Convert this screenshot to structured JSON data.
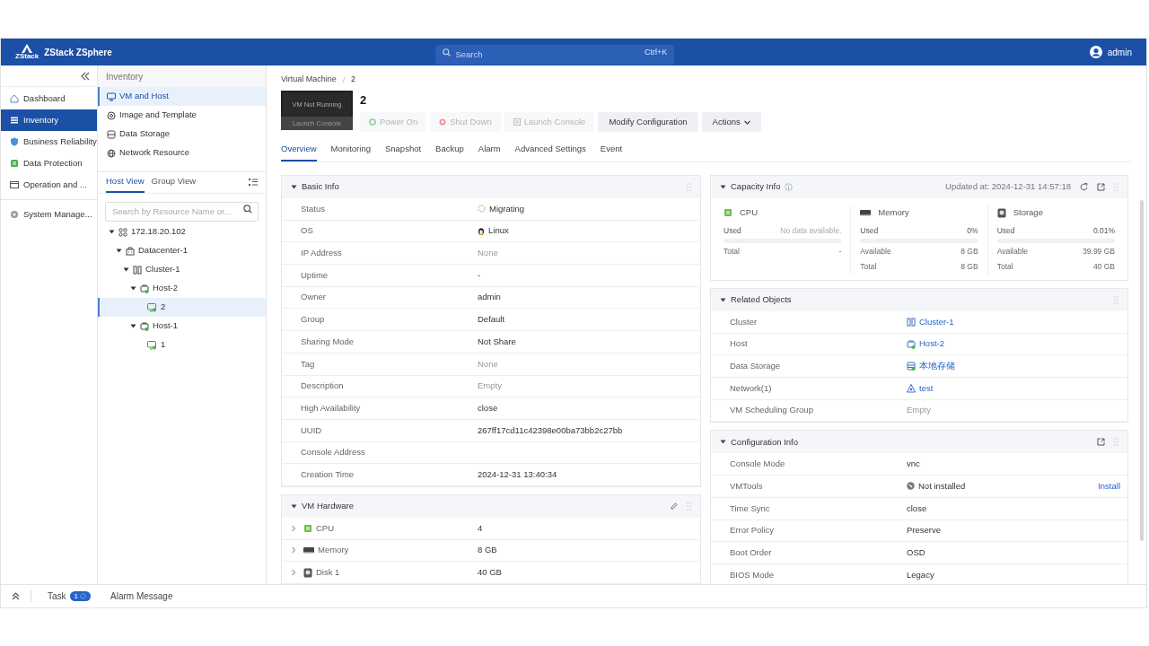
{
  "header": {
    "logo_mark": "ZStack",
    "product": "ZStack ZSphere",
    "search": {
      "placeholder": "Search",
      "shortcut": "Ctrl+K"
    },
    "user": "admin"
  },
  "nav": [
    {
      "label": "Dashboard",
      "selected": false
    },
    {
      "label": "Inventory",
      "selected": true
    },
    {
      "label": "Business Reliability",
      "selected": false
    },
    {
      "label": "Data Protection",
      "selected": false
    },
    {
      "label": "Operation and ...",
      "selected": false
    },
    {
      "label": "System Manage...",
      "selected": false
    }
  ],
  "subnav": {
    "title": "Inventory",
    "items": [
      {
        "label": "VM and Host",
        "selected": true
      },
      {
        "label": "Image and Template",
        "selected": false
      },
      {
        "label": "Data Storage",
        "selected": false
      },
      {
        "label": "Network Resource",
        "selected": false
      }
    ],
    "view_tabs": [
      {
        "label": "Host View",
        "selected": true
      },
      {
        "label": "Group View",
        "selected": false
      }
    ],
    "search": {
      "placeholder": "Search by Resource Name or..."
    },
    "tree": [
      {
        "label": "172.18.20.102",
        "kind": "zone",
        "expanded": true,
        "selected": false,
        "children": [
          {
            "label": "Datacenter-1",
            "kind": "datacenter",
            "expanded": true,
            "selected": false,
            "children": [
              {
                "label": "Cluster-1",
                "kind": "cluster",
                "expanded": true,
                "selected": false,
                "children": [
                  {
                    "label": "Host-2",
                    "kind": "host",
                    "expanded": true,
                    "selected": false,
                    "children": [
                      {
                        "label": "2",
                        "kind": "vm",
                        "selected": true
                      }
                    ]
                  },
                  {
                    "label": "Host-1",
                    "kind": "host",
                    "expanded": true,
                    "selected": false,
                    "children": [
                      {
                        "label": "1",
                        "kind": "vm",
                        "selected": false
                      }
                    ]
                  }
                ]
              }
            ]
          }
        ]
      }
    ]
  },
  "breadcrumb": [
    "Virtual Machine",
    "2"
  ],
  "vm": {
    "title": "2",
    "preview_status": "VM Not Running",
    "preview_action": "Launch Console"
  },
  "actions": [
    {
      "label": "Power On",
      "kind": "power_on",
      "disabled": true
    },
    {
      "label": "Shut Down",
      "kind": "shut_down",
      "disabled": true
    },
    {
      "label": "Launch Console",
      "kind": "console",
      "disabled": true
    },
    {
      "label": "Modify Configuration",
      "kind": "plain",
      "disabled": false
    },
    {
      "label": "Actions",
      "kind": "dropdown",
      "disabled": false
    }
  ],
  "tabs": [
    {
      "label": "Overview",
      "selected": true
    },
    {
      "label": "Monitoring",
      "selected": false
    },
    {
      "label": "Snapshot",
      "selected": false
    },
    {
      "label": "Backup",
      "selected": false
    },
    {
      "label": "Alarm",
      "selected": false
    },
    {
      "label": "Advanced Settings",
      "selected": false
    },
    {
      "label": "Event",
      "selected": false
    }
  ],
  "basic_info": {
    "title": "Basic Info",
    "expanded": true,
    "rows": [
      {
        "label": "Status",
        "value": "Migrating",
        "kind": "status"
      },
      {
        "label": "OS",
        "value": "Linux",
        "kind": "os"
      },
      {
        "label": "IP Address",
        "value": "None",
        "kind": "empty"
      },
      {
        "label": "Uptime",
        "value": "-",
        "kind": "plain"
      },
      {
        "label": "Owner",
        "value": "admin",
        "kind": "plain"
      },
      {
        "label": "Group",
        "value": "Default",
        "kind": "plain"
      },
      {
        "label": "Sharing Mode",
        "value": "Not Share",
        "kind": "plain"
      },
      {
        "label": "Tag",
        "value": "None",
        "kind": "empty"
      },
      {
        "label": "Description",
        "value": "Empty",
        "kind": "empty"
      },
      {
        "label": "High Availability",
        "value": "close",
        "kind": "plain"
      },
      {
        "label": "UUID",
        "value": "267ff17cd11c42398e00ba73bb2c27bb",
        "kind": "plain"
      },
      {
        "label": "Console Address",
        "kind": "plain"
      },
      {
        "label": "Creation Time",
        "value": "2024-12-31 13:40:34",
        "kind": "plain"
      }
    ]
  },
  "vm_hardware": {
    "title": "VM Hardware",
    "expanded": true,
    "rows": [
      {
        "label": "CPU",
        "value": "4",
        "kind": "cpu",
        "expanded": false
      },
      {
        "label": "Memory",
        "value": "8 GB",
        "kind": "memory",
        "expanded": false
      },
      {
        "label": "Disk 1",
        "value": "40 GB",
        "kind": "disk",
        "expanded": false
      }
    ]
  },
  "capacity_info": {
    "title": "Capacity Info",
    "expanded": true,
    "updated": "Updated at: 2024-12-31 14:57:18",
    "items": [
      {
        "name": "CPU",
        "kind": "cpu",
        "used_label": "Used",
        "used": "No data available.",
        "level": 0,
        "rows": [
          {
            "label": "Total",
            "value": "-"
          }
        ]
      },
      {
        "name": "Memory",
        "kind": "memory",
        "used_label": "Used",
        "used": "0%",
        "level": 0,
        "rows": [
          {
            "label": "Available",
            "value": "8 GB"
          },
          {
            "label": "Total",
            "value": "8 GB"
          }
        ]
      },
      {
        "name": "Storage",
        "kind": "disk",
        "used_label": "Used",
        "used": "0.01%",
        "level": 0.0001,
        "rows": [
          {
            "label": "Available",
            "value": "39.99 GB"
          },
          {
            "label": "Total",
            "value": "40 GB"
          }
        ]
      }
    ]
  },
  "related_objects": {
    "title": "Related Objects",
    "expanded": true,
    "rows": [
      {
        "label": "Cluster",
        "value": "Cluster-1",
        "kind": "cluster",
        "link": true
      },
      {
        "label": "Host",
        "value": "Host-2",
        "kind": "host",
        "link": true
      },
      {
        "label": "Data Storage",
        "value": "本地存储",
        "kind": "storage",
        "link": true
      },
      {
        "label": "Network(1)",
        "value": "test",
        "kind": "network",
        "link": true
      },
      {
        "label": "VM Scheduling Group",
        "value": "Empty",
        "kind": "plain",
        "link": false
      }
    ]
  },
  "configuration_info": {
    "title": "Configuration Info",
    "expanded": true,
    "rows": [
      {
        "label": "Console Mode",
        "value": "vnc",
        "kind": "plain"
      },
      {
        "label": "VMTools",
        "value": "Not installed",
        "kind": "tools",
        "action": "Install"
      },
      {
        "label": "Time Sync",
        "value": "close",
        "kind": "plain"
      },
      {
        "label": "Error Policy",
        "value": "Preserve",
        "kind": "plain"
      },
      {
        "label": "Boot Order",
        "value": "OSD",
        "kind": "plain"
      },
      {
        "label": "BIOS Mode",
        "value": "Legacy",
        "kind": "plain"
      }
    ]
  },
  "footer": {
    "task_label": "Task",
    "task_count": "1",
    "alarm_label": "Alarm Message"
  }
}
